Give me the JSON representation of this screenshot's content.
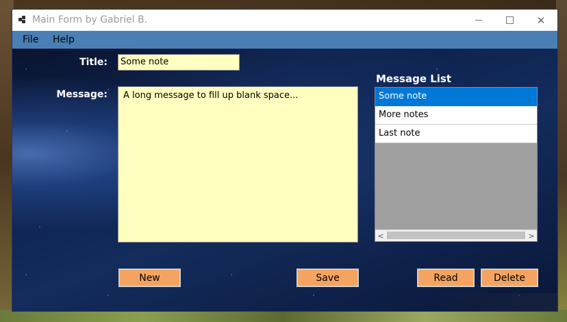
{
  "window": {
    "title": "Main Form by Gabriel B.",
    "close_glyph": "✕"
  },
  "menu": {
    "items": [
      {
        "label": "File"
      },
      {
        "label": "Help"
      }
    ]
  },
  "form": {
    "title_label": "Title:",
    "title_value": "Some note",
    "message_label": "Message:",
    "message_value": "A long message to fill up blank space..."
  },
  "list": {
    "label": "Message List",
    "items": [
      {
        "label": "Some note",
        "selected": true
      },
      {
        "label": "More notes",
        "selected": false
      },
      {
        "label": "Last note",
        "selected": false
      }
    ],
    "scroll_left_glyph": "<",
    "scroll_right_glyph": ">"
  },
  "buttons": {
    "new": "New",
    "save": "Save",
    "read": "Read",
    "delete": "Delete"
  },
  "colors": {
    "input_background": "#ffffc0",
    "button_background": "#f4a460",
    "menubar": "#4a7fb5",
    "selection": "#0078d7"
  },
  "icons": [
    "app-icon",
    "minimize-icon",
    "maximize-icon",
    "close-icon",
    "scroll-left-icon",
    "scroll-right-icon"
  ]
}
